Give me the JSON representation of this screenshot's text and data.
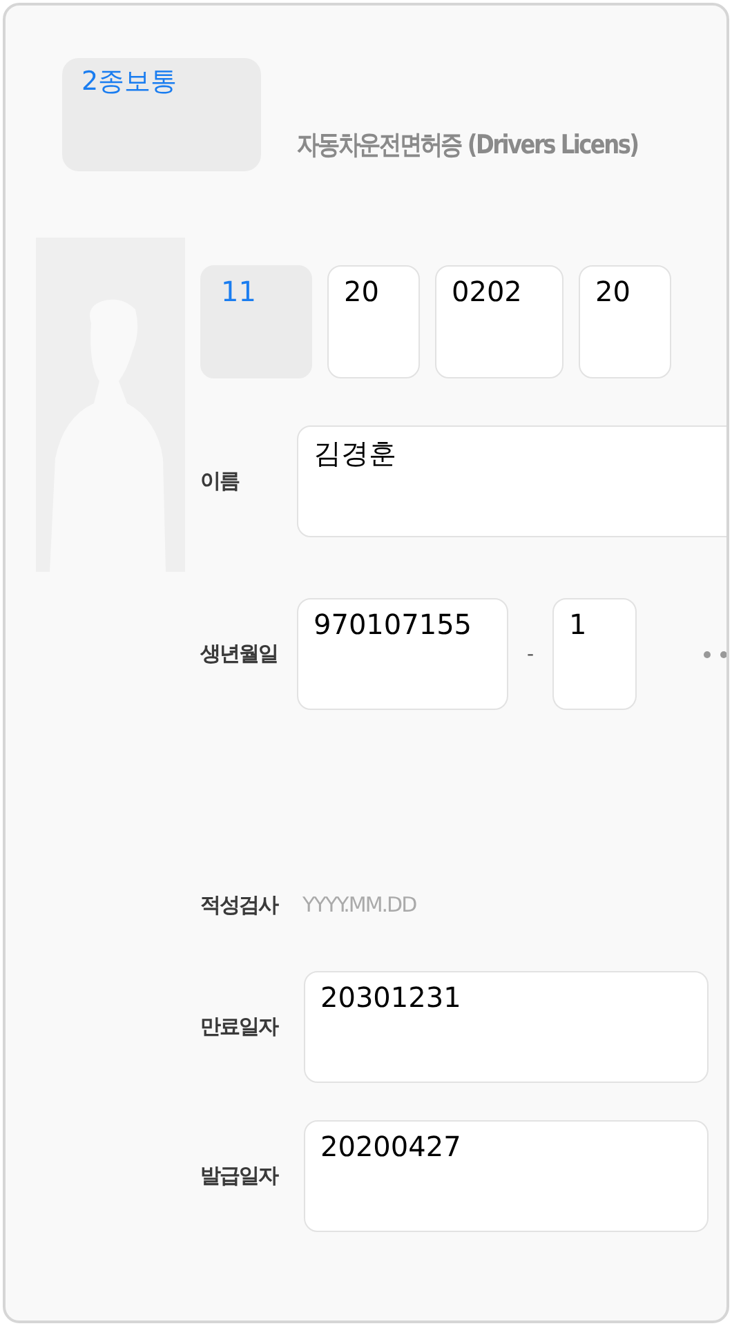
{
  "license_type": "2종보통",
  "title": "자동차운전면허증 (Drivers Licens)",
  "number_fields": [
    {
      "kind": "select",
      "value": "11"
    },
    {
      "kind": "input",
      "value": "20"
    },
    {
      "kind": "input",
      "value": "0202"
    },
    {
      "kind": "input",
      "value": "20"
    }
  ],
  "name": {
    "label": "이름",
    "value": "김경훈"
  },
  "birth": {
    "label": "생년월일",
    "front": "970107155",
    "separator": "-",
    "back": "1"
  },
  "aptitude_test": {
    "label": "적성검사",
    "placeholder": "YYYY.MM.DD"
  },
  "expiry": {
    "label": "만료일자",
    "value": "20301231"
  },
  "issue": {
    "label": "발급일자",
    "value": "20200427"
  }
}
